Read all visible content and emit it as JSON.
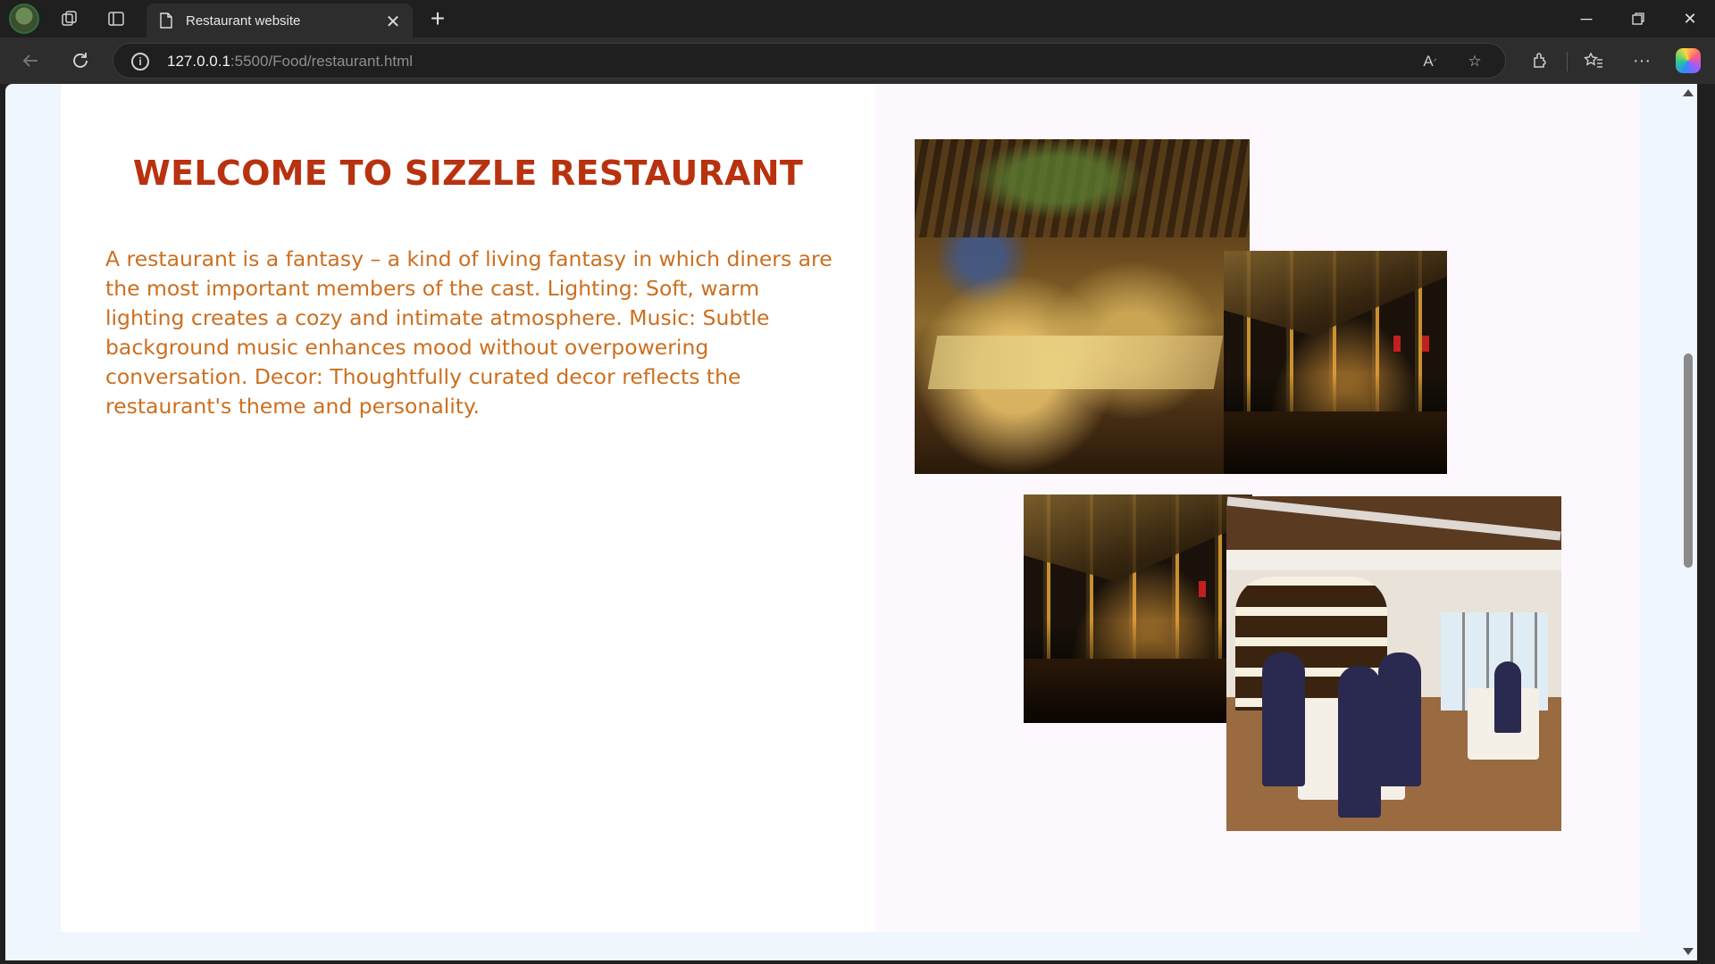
{
  "browser": {
    "tab_title": "Restaurant website",
    "url_host": "127.0.0.1",
    "url_path": ":5500/Food/restaurant.html"
  },
  "page": {
    "heading": "WELCOME TO SIZZLE RESTAURANT",
    "paragraph": "A restaurant is a fantasy – a kind of living fantasy in which diners are the most important members of the cast. Lighting: Soft, warm lighting creates a cozy and intimate atmosphere. Music: Subtle background music enhances mood without overpowering conversation. Decor: Thoughtfully curated decor reflects the restaurant's theme and personality."
  },
  "colors": {
    "heading": "#b8320f",
    "paragraph": "#cc6f1f",
    "page_bg": "#eff6fd",
    "right_panel_bg": "#fdf8fd"
  }
}
